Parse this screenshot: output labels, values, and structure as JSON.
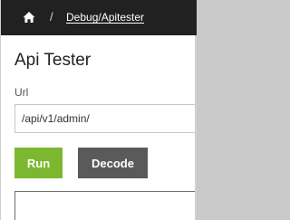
{
  "breadcrumb": {
    "home_icon": "home-icon",
    "separator": "/",
    "current_link": "Debug/Apitester"
  },
  "page": {
    "title": "Api Tester"
  },
  "url_field": {
    "label": "Url",
    "value": "/api/v1/admin/"
  },
  "buttons": {
    "run_label": "Run",
    "decode_label": "Decode"
  },
  "colors": {
    "breadcrumb_bg": "#212121",
    "run_button": "#7cb82f",
    "decode_button": "#5a5a5a"
  }
}
